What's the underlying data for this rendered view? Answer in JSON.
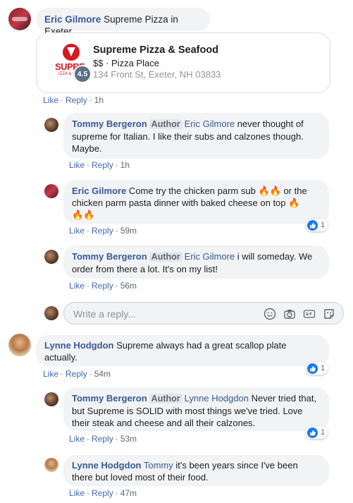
{
  "comment1": {
    "author": "Eric Gilmore",
    "text": "Supreme Pizza in Exeter",
    "like": "Like",
    "reply": "Reply",
    "time": "1h"
  },
  "page_card": {
    "name": "Supreme Pizza & Seafood",
    "category": "$$ · Pizza Place",
    "address": "134 Front St, Exeter, NH 03833",
    "rating": "4.5",
    "logo_text": "SUPRE",
    "logo_subtext": "IZZA & SE"
  },
  "reply1": {
    "author": "Tommy Bergeron",
    "badge": "Author",
    "mention": "Eric Gilmore",
    "text": " never thought of supreme for Italian. I like their subs and calzones though. Maybe.",
    "like": "Like",
    "reply": "Reply",
    "time": "1h"
  },
  "reply2": {
    "author": "Eric Gilmore",
    "text_a": " Come try the chicken parm sub ",
    "emoji_a": "🔥🔥",
    "text_b": " or the chicken parm pasta dinner with baked cheese on top ",
    "emoji_b": "🔥",
    "emoji_c": "🔥🔥",
    "like": "Like",
    "reply": "Reply",
    "time": "59m",
    "reaction_count": "1"
  },
  "reply3": {
    "author": "Tommy Bergeron",
    "badge": "Author",
    "mention": "Eric Gilmore",
    "text": " i will someday. We order from there a lot. It's on my list!",
    "like": "Like",
    "reply": "Reply",
    "time": "56m"
  },
  "reply_input": {
    "placeholder": "Write a reply...",
    "icons": [
      "emoji-icon",
      "camera-icon",
      "gif-icon",
      "sticker-icon"
    ]
  },
  "comment2": {
    "author": "Lynne Hodgdon",
    "text": " Supreme always had a great scallop plate actually.",
    "like": "Like",
    "reply": "Reply",
    "time": "54m",
    "reaction_count": "1"
  },
  "reply4": {
    "author": "Tommy Bergeron",
    "badge": "Author",
    "mention": "Lynne Hodgdon",
    "text": " Never tried that, but Supreme is SOLID with most things we've tried. Love their steak and cheese and all their calzones.",
    "like": "Like",
    "reply": "Reply",
    "time": "53m",
    "reaction_count": "1"
  },
  "reply5": {
    "author": "Lynne Hodgdon",
    "mention": "Tommy",
    "text": " it's been years since I've been there but loved most of their food.",
    "like": "Like",
    "reply": "Reply",
    "time": "47m"
  },
  "colors": {
    "link": "#385898",
    "action": "#4267b2",
    "bubble": "#f2f3f5",
    "like_blue": "#1877f2",
    "logo_red": "#d71920"
  }
}
